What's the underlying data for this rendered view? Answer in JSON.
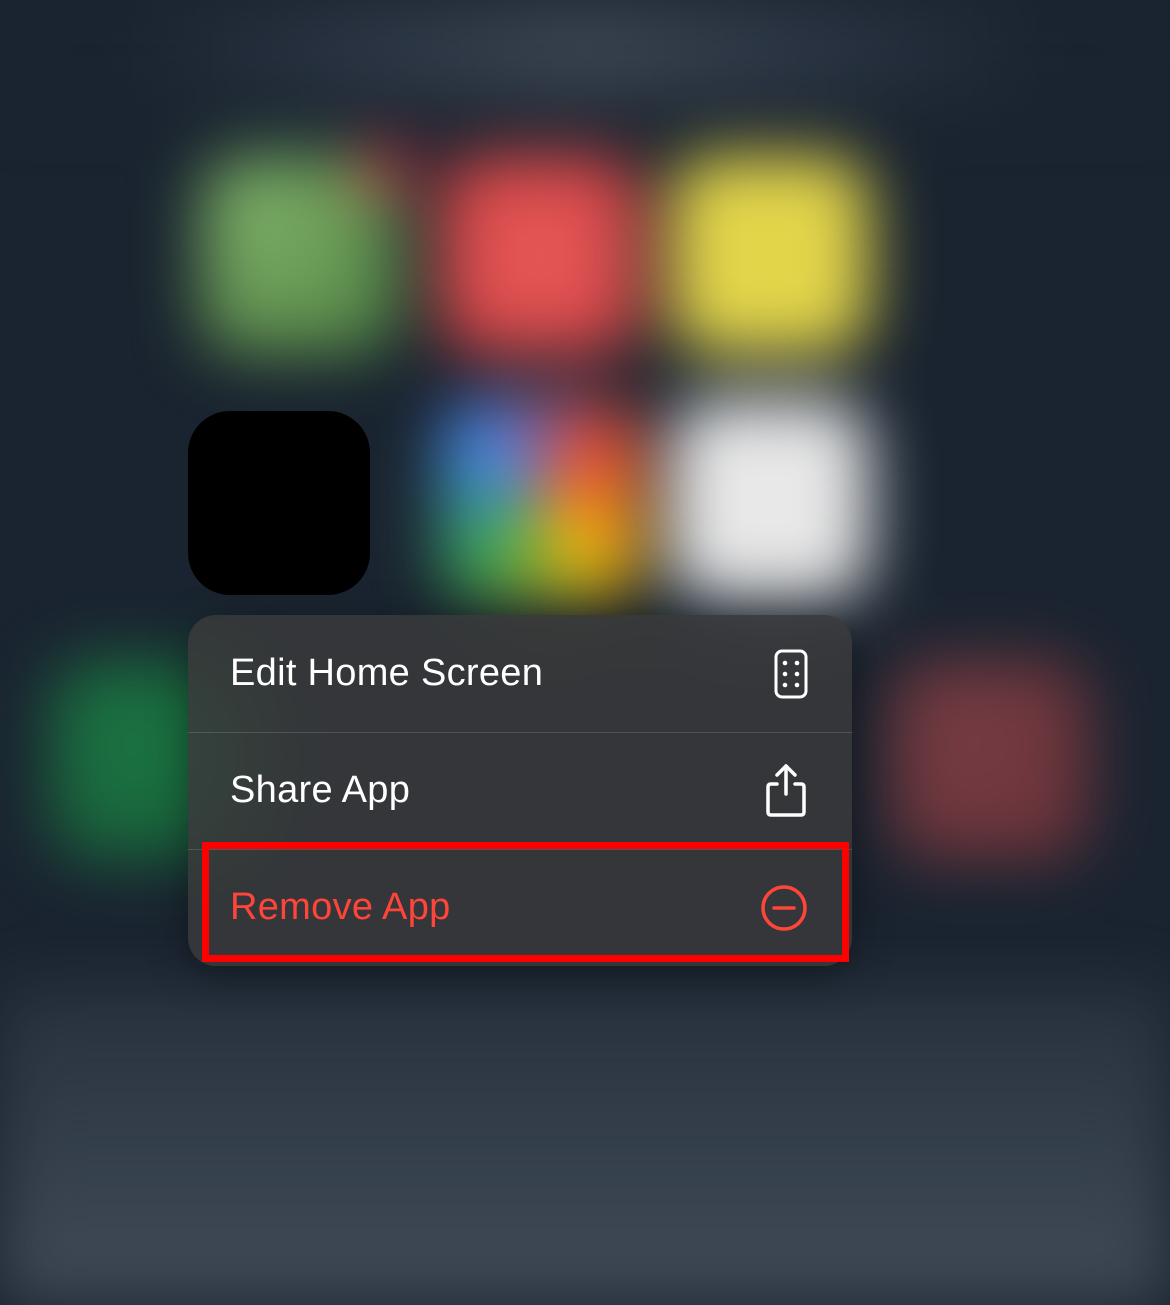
{
  "context_menu": {
    "items": [
      {
        "label": "Edit Home Screen",
        "icon": "app-grid-icon",
        "destructive": false
      },
      {
        "label": "Share App",
        "icon": "share-icon",
        "destructive": false
      },
      {
        "label": "Remove App",
        "icon": "minus-circle-icon",
        "destructive": true
      }
    ]
  },
  "colors": {
    "destructive": "#ff453a",
    "highlight": "#ff0000",
    "menu_bg": "rgba(58,58,60,0.82)",
    "text": "#ffffff"
  }
}
